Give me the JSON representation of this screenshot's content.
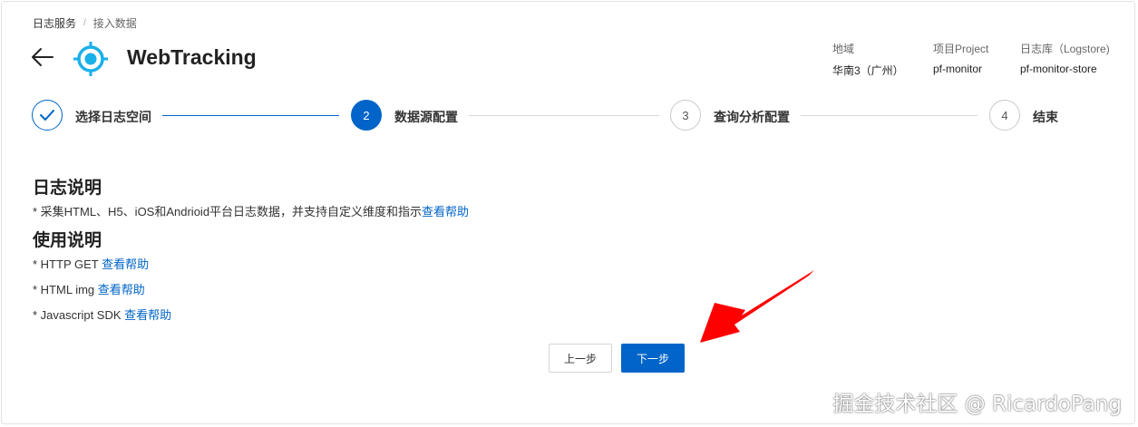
{
  "breadcrumb": {
    "root": "日志服务",
    "separator": "/",
    "current": "接入数据"
  },
  "header": {
    "title": "WebTracking"
  },
  "meta": [
    {
      "label": "地域",
      "value": "华南3（广州）"
    },
    {
      "label": "项目Project",
      "value": "pf-monitor"
    },
    {
      "label": "日志库（Logstore)",
      "value": "pf-monitor-store"
    }
  ],
  "steps": [
    {
      "number": "",
      "label": "选择日志空间",
      "status": "done"
    },
    {
      "number": "2",
      "label": "数据源配置",
      "status": "active"
    },
    {
      "number": "3",
      "label": "查询分析配置",
      "status": "todo"
    },
    {
      "number": "4",
      "label": "结束",
      "status": "todo"
    }
  ],
  "log_section": {
    "title": "日志说明",
    "text": "* 采集HTML、H5、iOS和Andrioid平台日志数据，并支持自定义维度和指示",
    "link": "查看帮助"
  },
  "usage_section": {
    "title": "使用说明",
    "items": [
      {
        "text": "* HTTP GET ",
        "link": "查看帮助"
      },
      {
        "text": "* HTML img ",
        "link": "查看帮助"
      },
      {
        "text": "* Javascript SDK ",
        "link": "查看帮助"
      }
    ]
  },
  "buttons": {
    "prev": "上一步",
    "next": "下一步"
  },
  "watermark": "掘金技术社区 @ RicardoPang",
  "colors": {
    "accent": "#0064c8",
    "logo": "#1ab0e8",
    "annotation_arrow": "#ff0000"
  }
}
